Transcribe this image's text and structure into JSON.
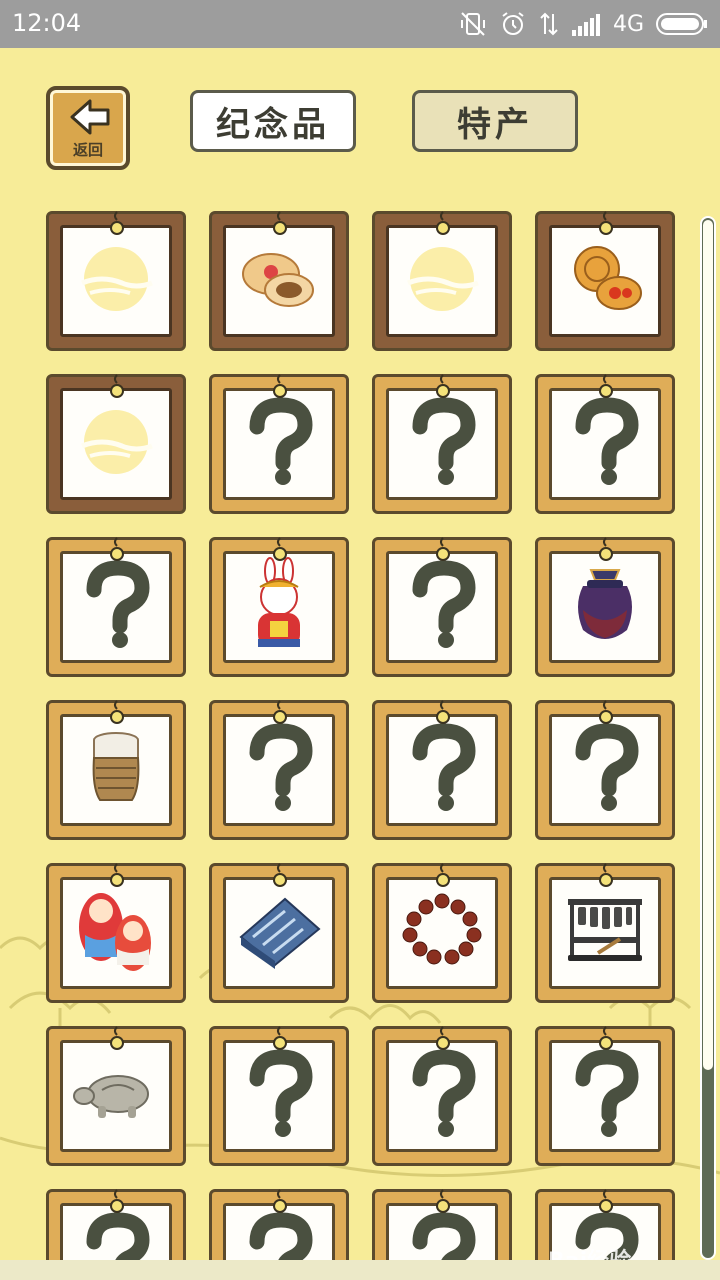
{
  "status_bar": {
    "time": "12:04",
    "network": "4G"
  },
  "nav": {
    "back_label": "返回"
  },
  "tabs": [
    {
      "label": "纪念品",
      "selected": true
    },
    {
      "label": "特产",
      "selected": false
    }
  ],
  "grid": {
    "cards": [
      {
        "item": "moon-placeholder-icon",
        "frame": "brown"
      },
      {
        "item": "pastry-icon",
        "frame": "brown"
      },
      {
        "item": "moon-placeholder-icon",
        "frame": "brown"
      },
      {
        "item": "mooncake-icon",
        "frame": "brown"
      },
      {
        "item": "moon-placeholder-icon",
        "frame": "brown"
      },
      {
        "item": "question-mark-icon",
        "frame": "gold"
      },
      {
        "item": "question-mark-icon",
        "frame": "gold"
      },
      {
        "item": "question-mark-icon",
        "frame": "gold"
      },
      {
        "item": "question-mark-icon",
        "frame": "gold"
      },
      {
        "item": "rabbit-figure-icon",
        "frame": "gold"
      },
      {
        "item": "question-mark-icon",
        "frame": "gold"
      },
      {
        "item": "jar-icon",
        "frame": "gold"
      },
      {
        "item": "basket-cup-icon",
        "frame": "gold"
      },
      {
        "item": "question-mark-icon",
        "frame": "gold"
      },
      {
        "item": "question-mark-icon",
        "frame": "gold"
      },
      {
        "item": "question-mark-icon",
        "frame": "gold"
      },
      {
        "item": "nesting-dolls-icon",
        "frame": "gold"
      },
      {
        "item": "folded-cloth-icon",
        "frame": "gold"
      },
      {
        "item": "prayer-beads-icon",
        "frame": "gold"
      },
      {
        "item": "bells-icon",
        "frame": "gold"
      },
      {
        "item": "stone-turtle-icon",
        "frame": "gold"
      },
      {
        "item": "question-mark-icon",
        "frame": "gold"
      },
      {
        "item": "question-mark-icon",
        "frame": "gold"
      },
      {
        "item": "question-mark-icon",
        "frame": "gold"
      },
      {
        "item": "question-mark-icon",
        "frame": "gold"
      },
      {
        "item": "question-mark-icon",
        "frame": "gold"
      },
      {
        "item": "question-mark-icon",
        "frame": "gold"
      },
      {
        "item": "question-mark-icon",
        "frame": "gold"
      }
    ]
  },
  "colors": {
    "background": "#f7ec98",
    "frame_gold": "#dfad58",
    "frame_brown": "#8a5e3b",
    "question_mark": "#4a5040"
  },
  "watermark": "Bai经验"
}
